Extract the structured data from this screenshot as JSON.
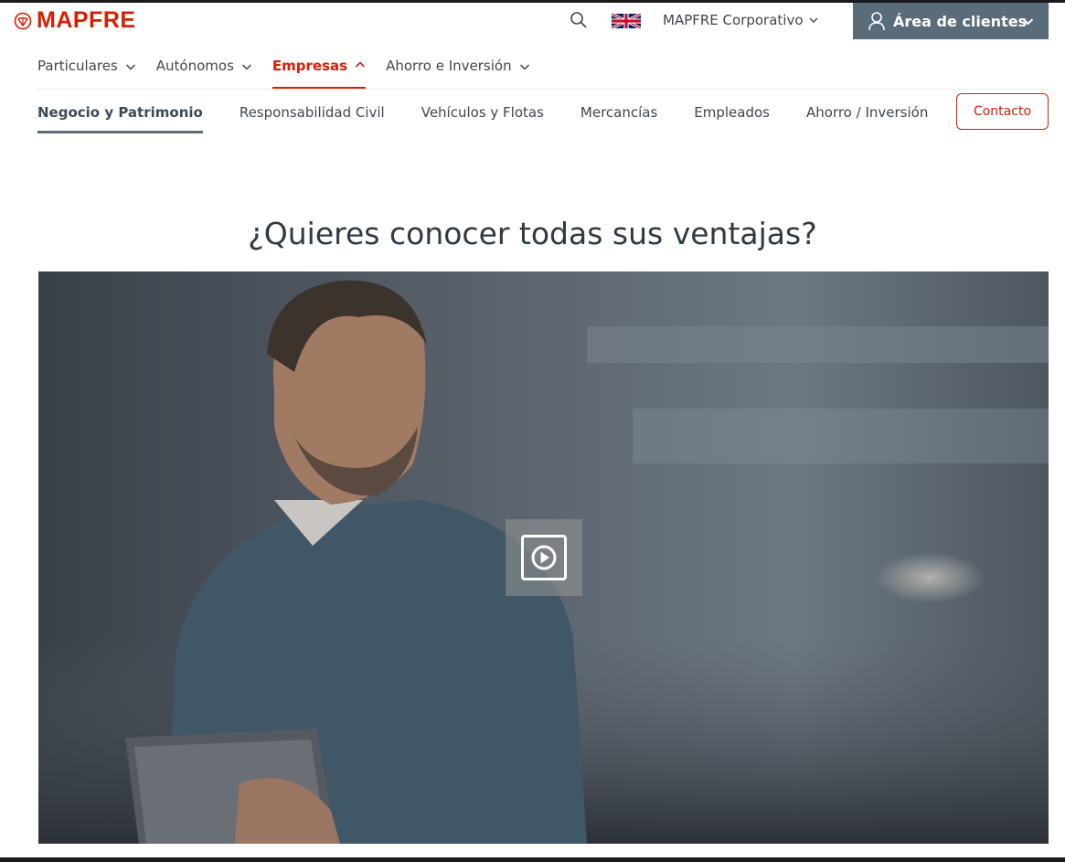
{
  "brand": {
    "name": "MAPFRE",
    "color": "#d81e05"
  },
  "utility": {
    "search_icon": "search-icon",
    "language_flag": "uk-flag-icon",
    "corporate_label": "MAPFRE Corporativo",
    "client_area_label": "Área de clientes"
  },
  "primary_nav": [
    {
      "label": "Particulares",
      "active": false
    },
    {
      "label": "Autónomos",
      "active": false
    },
    {
      "label": "Empresas",
      "active": true
    },
    {
      "label": "Ahorro e Inversión",
      "active": false
    }
  ],
  "sub_nav": [
    {
      "label": "Negocio y Patrimonio",
      "active": true
    },
    {
      "label": "Responsabilidad Civil",
      "active": false
    },
    {
      "label": "Vehículos y Flotas",
      "active": false
    },
    {
      "label": "Mercancías",
      "active": false
    },
    {
      "label": "Empleados",
      "active": false
    },
    {
      "label": "Ahorro / Inversión",
      "active": false
    }
  ],
  "contact_label": "Contacto",
  "section": {
    "title": "¿Quieres conocer todas sus ventajas?"
  },
  "video": {
    "play_icon": "play-icon"
  },
  "colors": {
    "accent": "#d81e05",
    "client_area_bg": "#5a6c7a",
    "text": "#41474d"
  }
}
